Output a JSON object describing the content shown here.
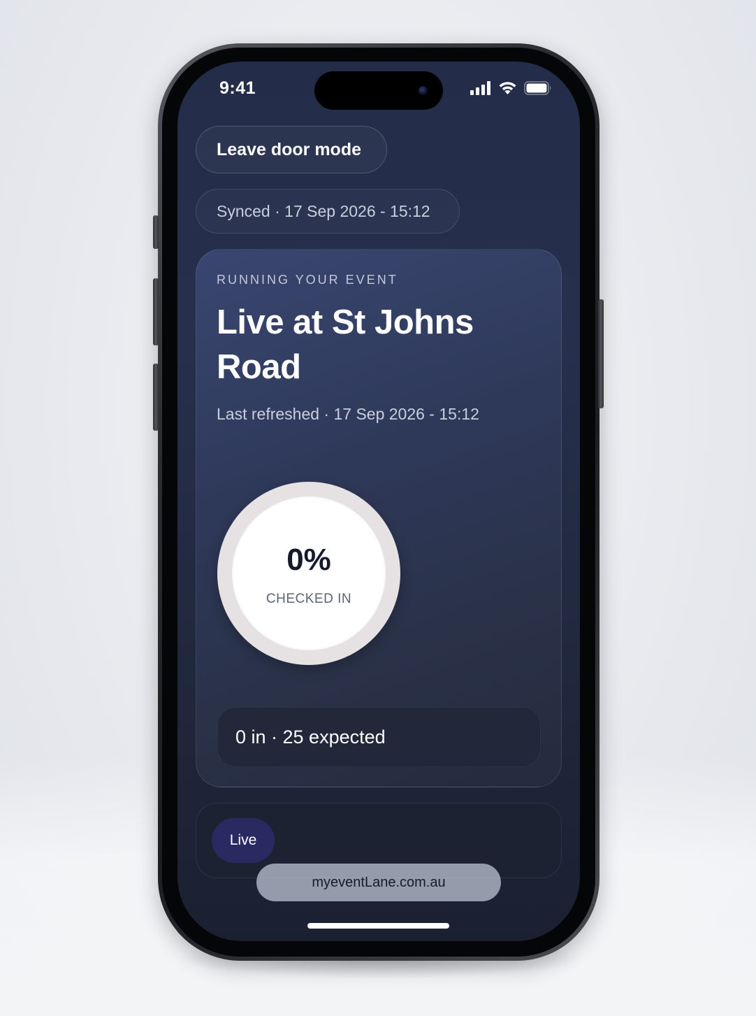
{
  "status_bar": {
    "time": "9:41",
    "icons": [
      "cellular-signal-icon",
      "wifi-icon",
      "battery-icon"
    ]
  },
  "door_mode": {
    "leave_label": "Leave door mode"
  },
  "sync": {
    "text": "Synced · 17 Sep 2026 - 15:12"
  },
  "event_card": {
    "eyebrow": "RUNNING YOUR EVENT",
    "title": "Live at St Johns Road",
    "refreshed": "Last refreshed · 17 Sep 2026 - 15:12",
    "checked_in_percent": "0%",
    "checked_in_label": "CHECKED IN",
    "checked_in_fraction": 0,
    "counts": "0 in · 25 expected"
  },
  "status_card": {
    "chip_label": "Live"
  },
  "browser": {
    "url": "myeventLane.com.au"
  },
  "colors": {
    "screen_bg": "#232c48",
    "card_bg": "#3a4670",
    "live_chip": "#2a2a63",
    "ring_track": "#e6e2e3",
    "text_primary": "#ffffff",
    "text_secondary": "#c9cfdc"
  }
}
